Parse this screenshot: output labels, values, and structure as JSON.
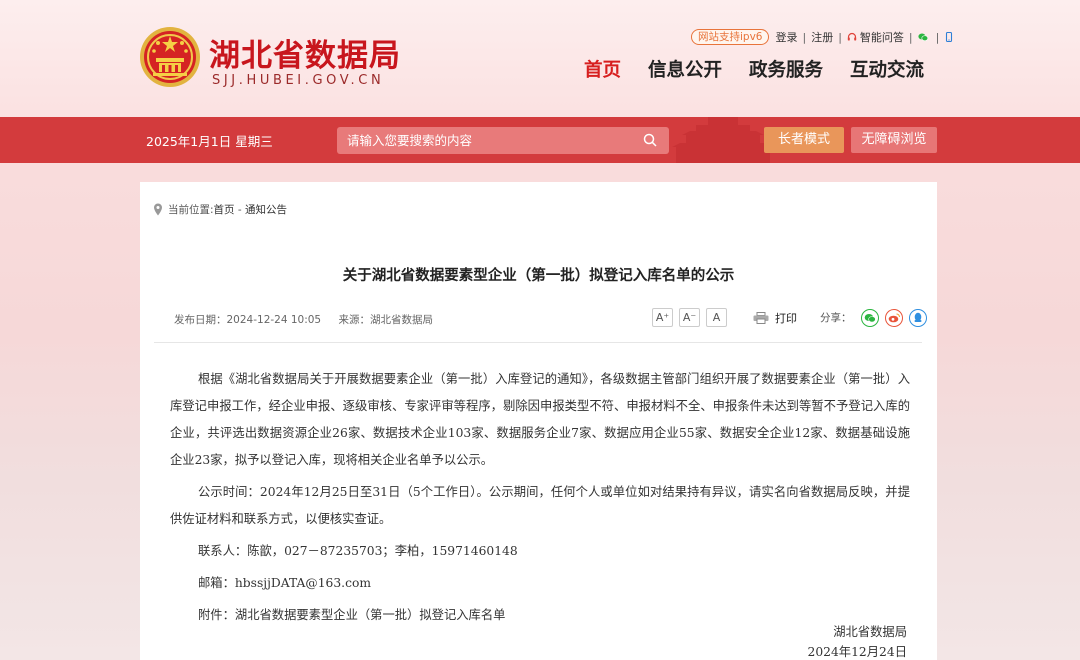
{
  "header": {
    "logo_cn": "湖北省数据局",
    "logo_en": "SJJ.HUBEI.GOV.CN",
    "ipv6_badge": "网站支持ipv6",
    "top_links": {
      "login": "登录",
      "register": "注册",
      "assistant": "智能问答"
    },
    "nav": [
      "首页",
      "信息公开",
      "政务服务",
      "互动交流"
    ]
  },
  "toolbar": {
    "date": "2025年1月1日 星期三",
    "search_placeholder": "请输入您要搜索的内容",
    "elder_mode": "长者模式",
    "accessible": "无障碍浏览"
  },
  "article": {
    "breadcrumb": {
      "label": "当前位置:",
      "home": "首页",
      "sep": " - ",
      "section": "通知公告"
    },
    "title": "关于湖北省数据要素型企业（第一批）拟登记入库名单的公示",
    "publish_date": "发布日期：2024-12-24 10:05",
    "source": "来源：湖北省数据局",
    "font_buttons": [
      "A⁺",
      "A⁻",
      "A"
    ],
    "print_label": "打印",
    "share_label": "分享：",
    "paragraphs": [
      "根据《湖北省数据局关于开展数据要素企业（第一批）入库登记的通知》，各级数据主管部门组织开展了数据要素企业（第一批）入库登记申报工作，经企业申报、逐级审核、专家评审等程序，剔除因申报类型不符、申报材料不全、申报条件未达到等暂不予登记入库的企业，共评选出数据资源企业26家、数据技术企业103家、数据服务企业7家、数据应用企业55家、数据安全企业12家、数据基础设施企业23家，拟予以登记入库，现将相关企业名单予以公示。",
      "公示时间：2024年12月25日至31日（5个工作日）。公示期间，任何个人或单位如对结果持有异议，请实名向省数据局反映，并提供佐证材料和联系方式，以便核实查证。"
    ],
    "contact": "联系人：陈歆，027－87235703；李柏，15971460148",
    "email": "邮箱：hbssjjDATA@163.com",
    "attachment": "附件：湖北省数据要素型企业（第一批）拟登记入库名单",
    "sign_org": "湖北省数据局",
    "sign_date": "2024年12月24日"
  },
  "colors": {
    "brand_red": "#d71f1f",
    "bar_red": "#d33b3d",
    "elder_orange": "#e9965a"
  }
}
